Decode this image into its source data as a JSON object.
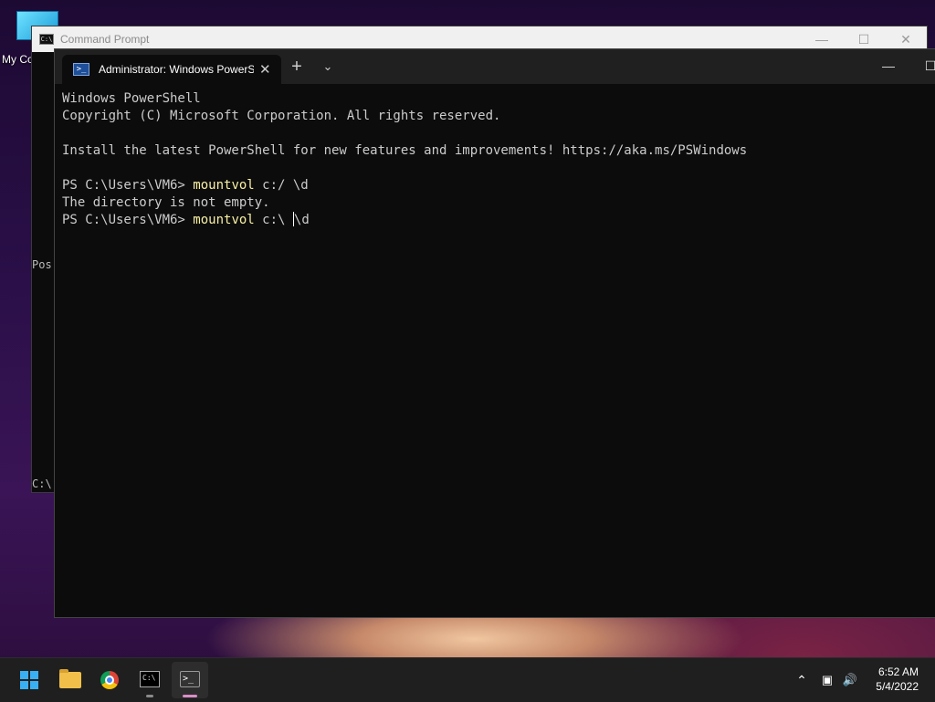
{
  "desktop": {
    "icon_label": "My Co"
  },
  "cmd_window": {
    "title": "Command Prompt",
    "icon_text": "C:\\",
    "controls": {
      "minimize": "—",
      "maximize": "☐",
      "close": "✕"
    },
    "partial_text_1": "Pos",
    "partial_text_2": "C:\\"
  },
  "terminal": {
    "tab_label": "Administrator: Windows PowerShell",
    "tab_icon_text": ">_",
    "tab_close": "✕",
    "new_tab": "+",
    "dropdown": "⌄",
    "controls": {
      "minimize": "—",
      "maximize": "☐"
    },
    "lines": {
      "l1": "Windows PowerShell",
      "l2": "Copyright (C) Microsoft Corporation. All rights reserved.",
      "l3": "Install the latest PowerShell for new features and improvements! https://aka.ms/PSWindows",
      "l4_prompt": "PS C:\\Users\\VM6> ",
      "l4_cmd": "mountvol",
      "l4_args": " c:/ \\d",
      "l5": "The directory is not empty.",
      "l6_prompt": "PS C:\\Users\\VM6> ",
      "l6_cmd": "mountvol",
      "l6_args_before": " c:\\ ",
      "l6_args_after": "\\d"
    }
  },
  "taskbar": {
    "cmd_icon_text": "C:\\",
    "terminal_icon_text": ">_",
    "tray": {
      "chevron": "⌃",
      "network": "▣",
      "volume": "🔊"
    },
    "clock": {
      "time": "6:52 AM",
      "date": "5/4/2022"
    }
  }
}
